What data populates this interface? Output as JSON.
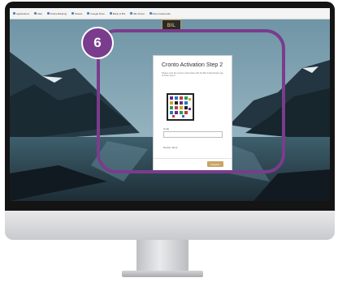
{
  "bookmarks": [
    {
      "label": "Applications"
    },
    {
      "label": "Mail"
    },
    {
      "label": "Online Banking"
    },
    {
      "label": "Sheets"
    },
    {
      "label": "Google Drive"
    },
    {
      "label": "Bank of BIL"
    },
    {
      "label": "BIL Portal"
    },
    {
      "label": "More bookmarks"
    }
  ],
  "logo": {
    "text": "BIL"
  },
  "card": {
    "title": "Cronto Activation Step 2",
    "description": "Please scan the Cronto code below with the BIL Authenticator app to finish step 2.",
    "code_label": "Code",
    "code_value": "",
    "device_name_label": "Device name",
    "register_label": "Register"
  },
  "annotation": {
    "step": "6",
    "color": "#7a3c8c"
  },
  "colors": {
    "accent_gold": "#c8a465"
  }
}
